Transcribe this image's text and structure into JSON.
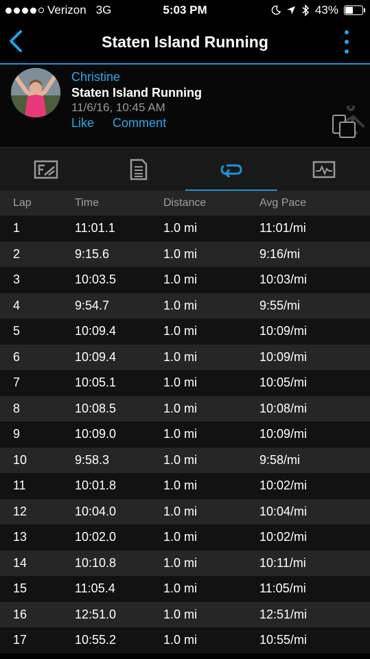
{
  "status_bar": {
    "carrier": "Verizon",
    "network": "3G",
    "time": "5:03 PM",
    "battery": "43%",
    "battery_level": 0.43
  },
  "nav": {
    "title": "Staten Island Running"
  },
  "activity": {
    "user": "Christine",
    "title": "Staten Island Running",
    "date": "11/6/16, 10:45 AM",
    "like_label": "Like",
    "comment_label": "Comment"
  },
  "tabs": [
    {
      "icon": "summary-icon",
      "active": false
    },
    {
      "icon": "details-icon",
      "active": false
    },
    {
      "icon": "laps-icon",
      "active": true
    },
    {
      "icon": "chart-icon",
      "active": false
    }
  ],
  "colors": {
    "accent": "#1a95d8",
    "link": "#2ba8ef"
  },
  "table": {
    "headers": [
      "Lap",
      "Time",
      "Distance",
      "Avg Pace"
    ],
    "rows": [
      [
        "1",
        "11:01.1",
        "1.0 mi",
        "11:01/mi"
      ],
      [
        "2",
        "9:15.6",
        "1.0 mi",
        "9:16/mi"
      ],
      [
        "3",
        "10:03.5",
        "1.0 mi",
        "10:03/mi"
      ],
      [
        "4",
        "9:54.7",
        "1.0 mi",
        "9:55/mi"
      ],
      [
        "5",
        "10:09.4",
        "1.0 mi",
        "10:09/mi"
      ],
      [
        "6",
        "10:09.4",
        "1.0 mi",
        "10:09/mi"
      ],
      [
        "7",
        "10:05.1",
        "1.0 mi",
        "10:05/mi"
      ],
      [
        "8",
        "10:08.5",
        "1.0 mi",
        "10:08/mi"
      ],
      [
        "9",
        "10:09.0",
        "1.0 mi",
        "10:09/mi"
      ],
      [
        "10",
        "9:58.3",
        "1.0 mi",
        "9:58/mi"
      ],
      [
        "11",
        "10:01.8",
        "1.0 mi",
        "10:02/mi"
      ],
      [
        "12",
        "10:04.0",
        "1.0 mi",
        "10:04/mi"
      ],
      [
        "13",
        "10:02.0",
        "1.0 mi",
        "10:02/mi"
      ],
      [
        "14",
        "10:10.8",
        "1.0 mi",
        "10:11/mi"
      ],
      [
        "15",
        "11:05.4",
        "1.0 mi",
        "11:05/mi"
      ],
      [
        "16",
        "12:51.0",
        "1.0 mi",
        "12:51/mi"
      ],
      [
        "17",
        "10:55.2",
        "1.0 mi",
        "10:55/mi"
      ]
    ]
  }
}
